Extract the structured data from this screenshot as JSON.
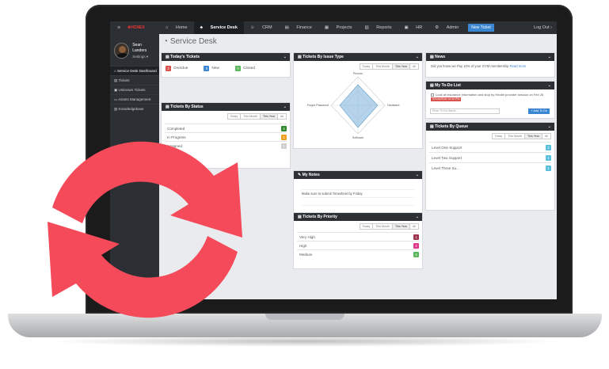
{
  "topnav": {
    "logo": "✚HCNEX",
    "items": [
      {
        "label": "Home",
        "icon": "home-icon",
        "active": false
      },
      {
        "label": "Service Desk",
        "icon": "desk-icon",
        "active": true
      },
      {
        "label": "CRM",
        "icon": "users-icon",
        "active": false
      },
      {
        "label": "Finance",
        "icon": "finance-icon",
        "active": false
      },
      {
        "label": "Projects",
        "icon": "projects-icon",
        "active": false
      },
      {
        "label": "Reports",
        "icon": "reports-icon",
        "active": false
      },
      {
        "label": "HR",
        "icon": "hr-icon",
        "active": false
      },
      {
        "label": "Admin",
        "icon": "gear-icon",
        "active": false
      }
    ],
    "new_ticket": "New Ticket",
    "logout": "Log Out ›"
  },
  "profile": {
    "name": "Sean Landers",
    "settings": "Settings ▾"
  },
  "sidebar": {
    "items": [
      {
        "label": "Service Desk Dashboard",
        "active": true
      },
      {
        "label": "Tickets",
        "active": false
      },
      {
        "label": "Unknown Tickets",
        "active": false
      },
      {
        "label": "Assets Management",
        "active": false
      },
      {
        "label": "Knowledgebase",
        "active": false
      }
    ]
  },
  "page_title": "Service Desk",
  "filters": [
    "Today",
    "This Month",
    "This Year",
    "All"
  ],
  "today": {
    "title": "Today's Tickets",
    "items": [
      {
        "count": "2",
        "label": "Overdue",
        "color": "#d9534f"
      },
      {
        "count": "0",
        "label": "New",
        "color": "#3a86d0"
      },
      {
        "count": "0",
        "label": "Closed",
        "color": "#5cb85c"
      }
    ]
  },
  "status": {
    "title": "Tickets By Status",
    "rows": [
      {
        "label": "Completed",
        "count": "4",
        "color": "#2e8b2e"
      },
      {
        "label": "In Progress",
        "count": "1",
        "color": "#f0a020"
      },
      {
        "label": "Assigned",
        "count": "1",
        "color": "#cfcfcf"
      }
    ]
  },
  "issue_type": {
    "title": "Tickets By Issue Type",
    "axes": [
      "Phones",
      "Hardware",
      "Software",
      "Forgot Password"
    ]
  },
  "notes": {
    "title": "My Notes",
    "lines": [
      "",
      "Make sure to submit Timesheet by Friday",
      "",
      ""
    ]
  },
  "priority": {
    "title": "Tickets By Priority",
    "rows": [
      {
        "label": "Very High",
        "count": "1",
        "color": "#a0344c"
      },
      {
        "label": "High",
        "count": "2",
        "color": "#e0358a"
      },
      {
        "label": "Medium",
        "count": "4",
        "color": "#5cb85c"
      }
    ]
  },
  "news": {
    "title": "News",
    "text": "Did you know we Pay 10% of your GYM membership",
    "more": "Read more"
  },
  "todo": {
    "title": "My To-Do List",
    "item": "Look at insurance information and stop by Health provider session on Feb 26",
    "due": "02/14/2016 14:30 PM",
    "placeholder": "Enter To Do Name...",
    "add": "+ Add To Do"
  },
  "queue": {
    "title": "Tickets By Queue",
    "rows": [
      {
        "label": "Level One Support",
        "count": "2",
        "color": "#5bc0de"
      },
      {
        "label": "Level Two Support",
        "count": "1",
        "color": "#5bc0de"
      },
      {
        "label": "Level Three Su...",
        "count": "1",
        "color": "#5bc0de"
      }
    ]
  },
  "colors": {
    "refresh_icon": "#f44a5a",
    "nav_bg": "#2c3035",
    "accent": "#3a86d0"
  }
}
